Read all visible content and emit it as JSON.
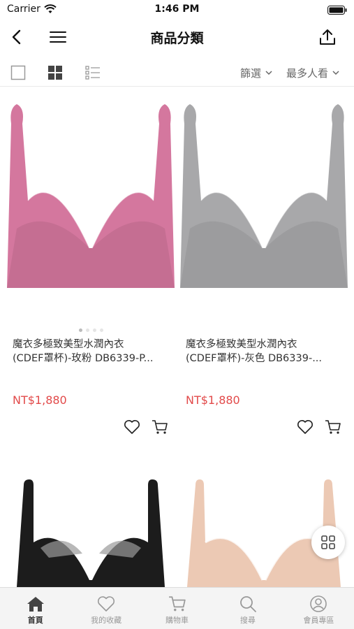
{
  "status_bar": {
    "carrier": "Carrier",
    "time": "1:46 PM"
  },
  "nav": {
    "title": "商品分類"
  },
  "toolbar": {
    "filter_label": "篩選",
    "sort_label": "最多人看"
  },
  "products": [
    {
      "name_line1": "魔衣多極致美型水潤內衣",
      "name_line2": "(CDEF罩杯)-玫粉 DB6339-P...",
      "price": "NT$1,880",
      "color": "#d4779e"
    },
    {
      "name_line1": "魔衣多極致美型水潤內衣",
      "name_line2": "(CDEF罩杯)-灰色 DB6339-...",
      "price": "NT$1,880",
      "color": "#a8a8aa"
    },
    {
      "color": "#1c1c1c"
    },
    {
      "color": "#ecc9b4"
    }
  ],
  "tabs": [
    {
      "label": "首頁",
      "icon": "home-icon",
      "active": true
    },
    {
      "label": "我的收藏",
      "icon": "heart-icon",
      "active": false
    },
    {
      "label": "購物車",
      "icon": "cart-icon",
      "active": false
    },
    {
      "label": "搜尋",
      "icon": "search-icon",
      "active": false
    },
    {
      "label": "會員專區",
      "icon": "user-icon",
      "active": false
    }
  ]
}
